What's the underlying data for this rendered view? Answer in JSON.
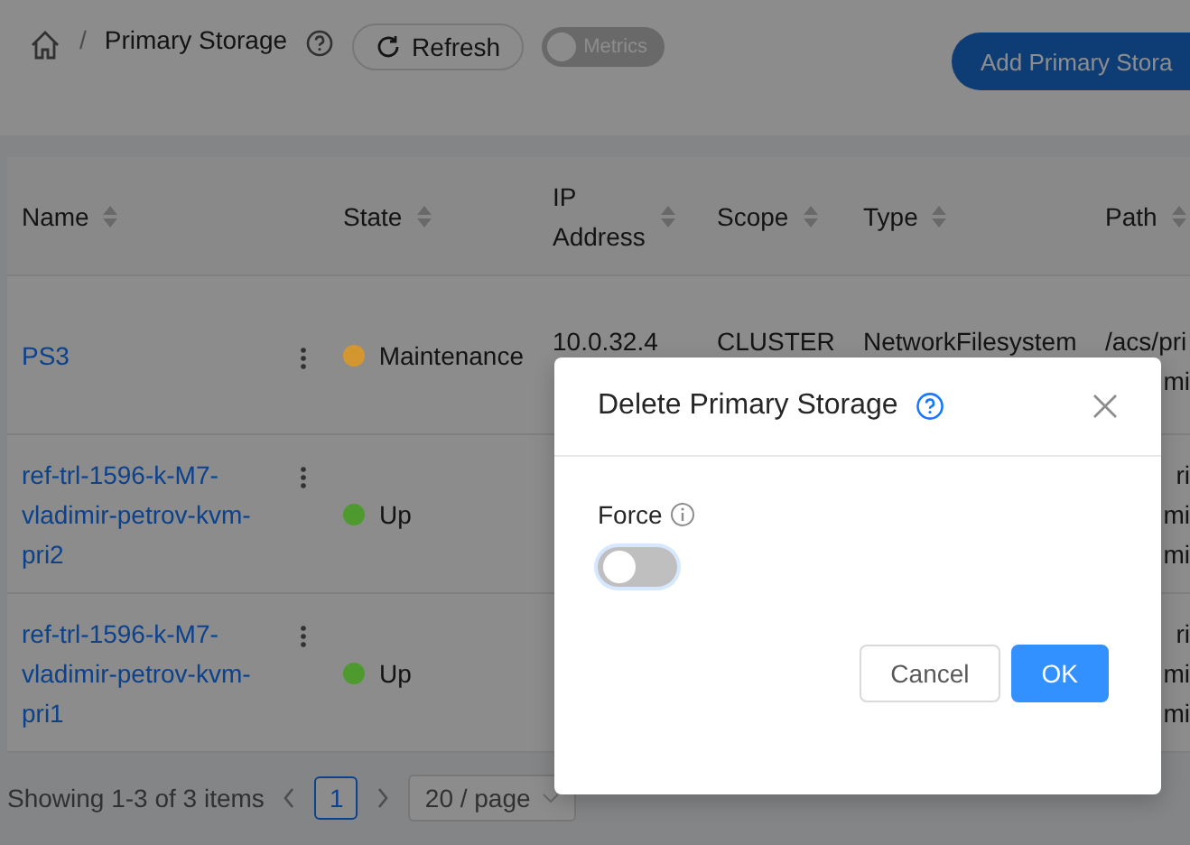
{
  "breadcrumb": {
    "separator": "/",
    "page_title": "Primary Storage"
  },
  "toolbar": {
    "refresh_label": "Refresh",
    "metrics": {
      "label": "Metrics",
      "on": false
    },
    "add_button": "Add Primary Stora"
  },
  "table": {
    "columns": [
      "Name",
      "State",
      "IP Address",
      "Scope",
      "Type",
      "Path"
    ],
    "rows": [
      {
        "name": "PS3",
        "state": "Maintenance",
        "color": "#d4972f",
        "ip": "10.0.32.4",
        "scope": "CLUSTER",
        "type": "NetworkFilesystem",
        "path": [
          "/acs/pri",
          "mi"
        ]
      },
      {
        "name": "ref-trl-1596-k-M7-vladimir-petrov-kvm-pri2",
        "state": "Up",
        "color": "#4e9a2e",
        "path": [
          "ri",
          "mi",
          "mi"
        ]
      },
      {
        "name": "ref-trl-1596-k-M7-vladimir-petrov-kvm-pri1",
        "state": "Up",
        "color": "#4e9a2e",
        "path": [
          "ri",
          "mi",
          "mi"
        ]
      }
    ]
  },
  "pagination": {
    "summary": "Showing 1-3 of 3 items",
    "pages": [
      {
        "label": "1",
        "selected": true
      }
    ],
    "page_size": "20 / page"
  },
  "dialog": {
    "title": "Delete Primary Storage",
    "fields": [
      {
        "label": "Force",
        "kind": "switch",
        "on": false
      }
    ],
    "buttons": [
      {
        "label": "Cancel",
        "kind": "default"
      },
      {
        "label": "OK",
        "kind": "primary"
      }
    ]
  }
}
